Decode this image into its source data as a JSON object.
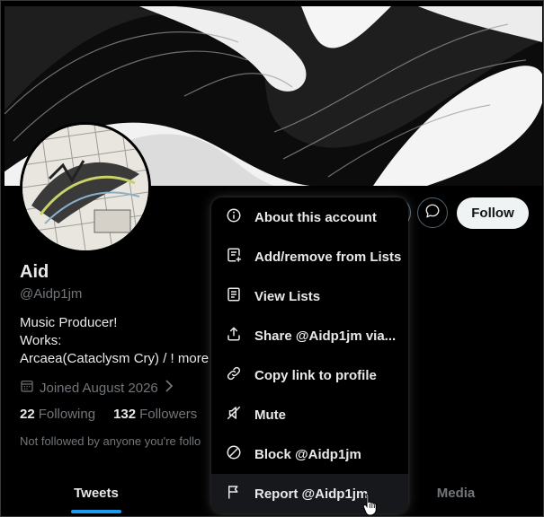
{
  "profile": {
    "name": "Aid",
    "handle": "@Aidp1jm",
    "bio_lines": [
      "Music Producer!",
      "Works:",
      "Arcaea(Cataclysm Cry) / ! more"
    ],
    "joined": "Joined August 2026",
    "following_count": "22",
    "following_label": "Following",
    "followers_count": "132",
    "followers_label": "Followers",
    "not_followed": "Not followed by anyone you're follo"
  },
  "actions": {
    "follow_label": "Follow",
    "message_icon": "message-icon"
  },
  "menu": {
    "items": [
      {
        "label": "About this account",
        "icon": "info-icon"
      },
      {
        "label": "Add/remove from Lists",
        "icon": "list-add-icon"
      },
      {
        "label": "View Lists",
        "icon": "list-icon"
      },
      {
        "label": "Share @Aidp1jm via...",
        "icon": "share-icon"
      },
      {
        "label": "Copy link to profile",
        "icon": "link-icon"
      },
      {
        "label": "Mute",
        "icon": "mute-icon"
      },
      {
        "label": "Block @Aidp1jm",
        "icon": "block-icon"
      },
      {
        "label": "Report @Aidp1jm",
        "icon": "flag-icon"
      }
    ]
  },
  "tabs": {
    "tweets": "Tweets",
    "media": "Media"
  },
  "colors": {
    "accent": "#1d9bf0",
    "text": "#e7e9ea",
    "muted": "#71767b",
    "background": "#000000"
  }
}
